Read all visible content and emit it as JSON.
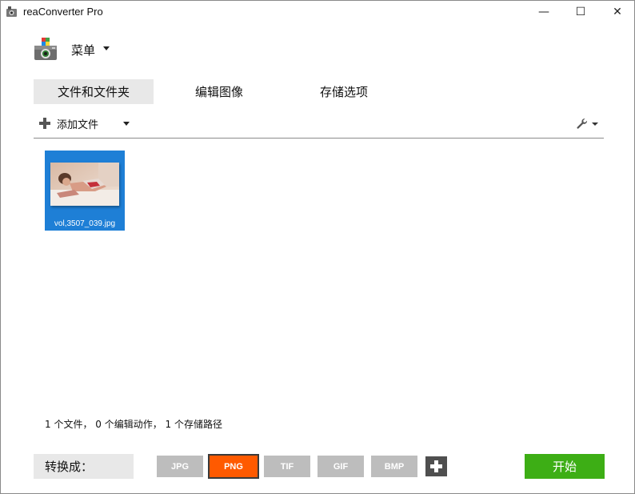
{
  "window": {
    "title": "reaConverter Pro",
    "minimize_glyph": "—",
    "maximize_glyph": "☐",
    "close_glyph": "✕"
  },
  "menu": {
    "label": "菜单"
  },
  "tabs": [
    {
      "label": "文件和文件夹",
      "active": true
    },
    {
      "label": "编辑图像",
      "active": false
    },
    {
      "label": "存储选项",
      "active": false
    }
  ],
  "toolbar": {
    "add_files_label": "添加文件",
    "settings_icon": "wrench-icon"
  },
  "files": [
    {
      "name": "vol,3507_039.jpg",
      "selected": true
    }
  ],
  "status": {
    "text": "1 个文件， 0 个编辑动作， 1 个存储路径"
  },
  "bottom": {
    "convert_label": "转换成：",
    "formats": [
      {
        "label": "JPG",
        "selected": false
      },
      {
        "label": "PNG",
        "selected": true
      },
      {
        "label": "TIF",
        "selected": false
      },
      {
        "label": "GIF",
        "selected": false
      },
      {
        "label": "BMP",
        "selected": false
      }
    ],
    "start_label": "开始"
  },
  "colors": {
    "selected_format": "#ff5a00",
    "format_default": "#bdbdbd",
    "start_button": "#3dae15",
    "file_selection": "#1e7fd6"
  }
}
